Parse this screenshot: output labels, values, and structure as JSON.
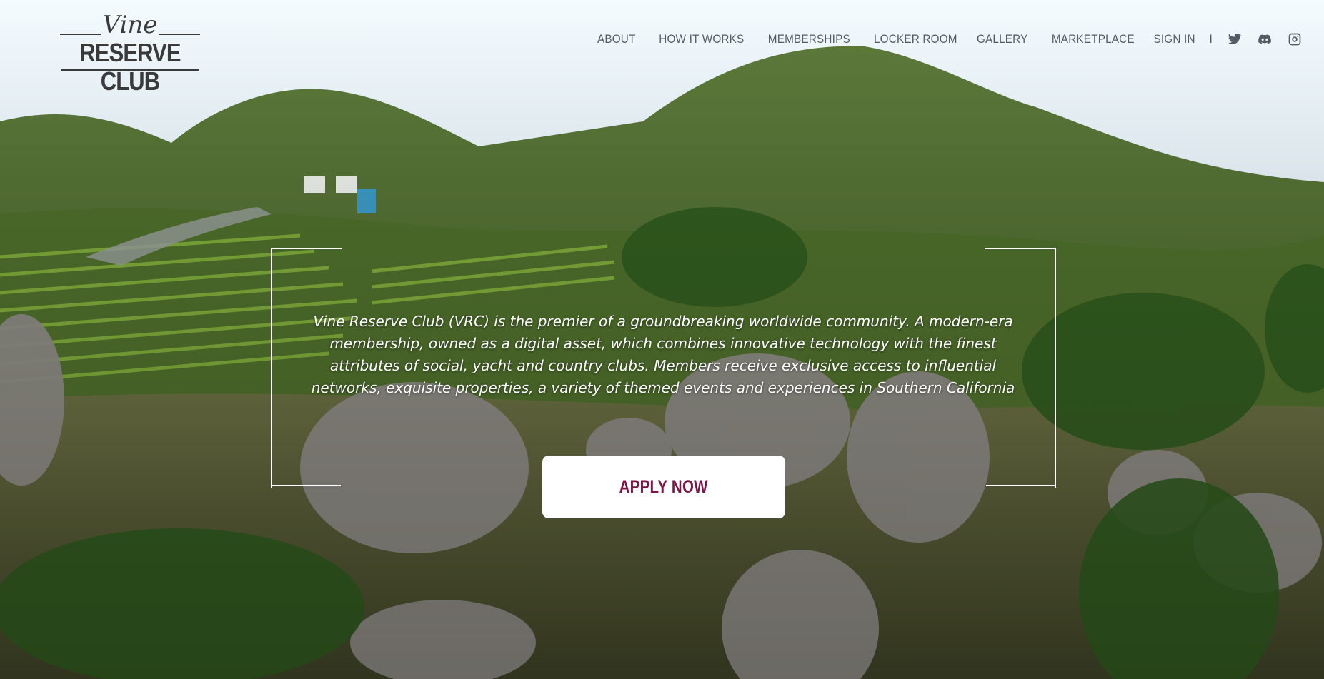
{
  "logo": {
    "script": "Vine",
    "main": "RESERVE CLUB"
  },
  "nav": {
    "items": [
      "ABOUT",
      "HOW IT WORKS",
      "MEMBERSHIPS",
      "LOCKER ROOM",
      "GALLERY",
      "MARKETPLACE",
      "SIGN IN"
    ],
    "separator": "I",
    "social_icons": [
      "twitter-icon",
      "discord-icon",
      "instagram-icon"
    ]
  },
  "hero": {
    "intro": "Vine Reserve Club (VRC) is the premier of a groundbreaking worldwide community. A modern-era membership, owned as a digital asset, which combines innovative technology with the finest attributes of social, yacht and country clubs. Members receive exclusive access to influential networks, exquisite properties, a variety of themed events and experiences in Southern California",
    "cta": "APPLY NOW"
  },
  "colors": {
    "accent": "#7c1546",
    "nav_text": "#555b62",
    "logo": "#3a3a3a"
  }
}
